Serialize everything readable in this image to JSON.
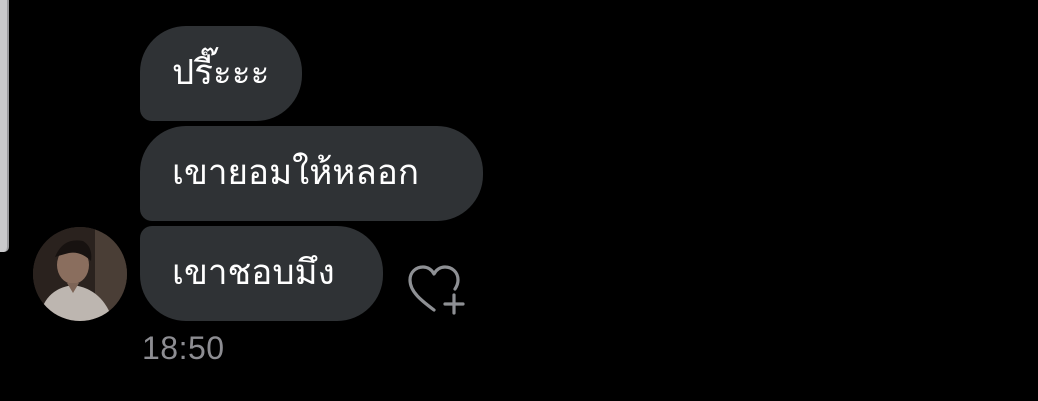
{
  "chat": {
    "messages": [
      {
        "text": "ปรี๊ะะะ"
      },
      {
        "text": "เขายอมให้หลอก"
      },
      {
        "text": "เขาชอบมึง"
      }
    ],
    "timestamp": "18:50",
    "sender_avatar_icon": "avatar-photo",
    "reaction_icon": "heart-plus-icon"
  },
  "colors": {
    "background": "#000000",
    "bubble": "#2f3235",
    "text": "#ffffff",
    "timestamp": "#8d8d92"
  }
}
